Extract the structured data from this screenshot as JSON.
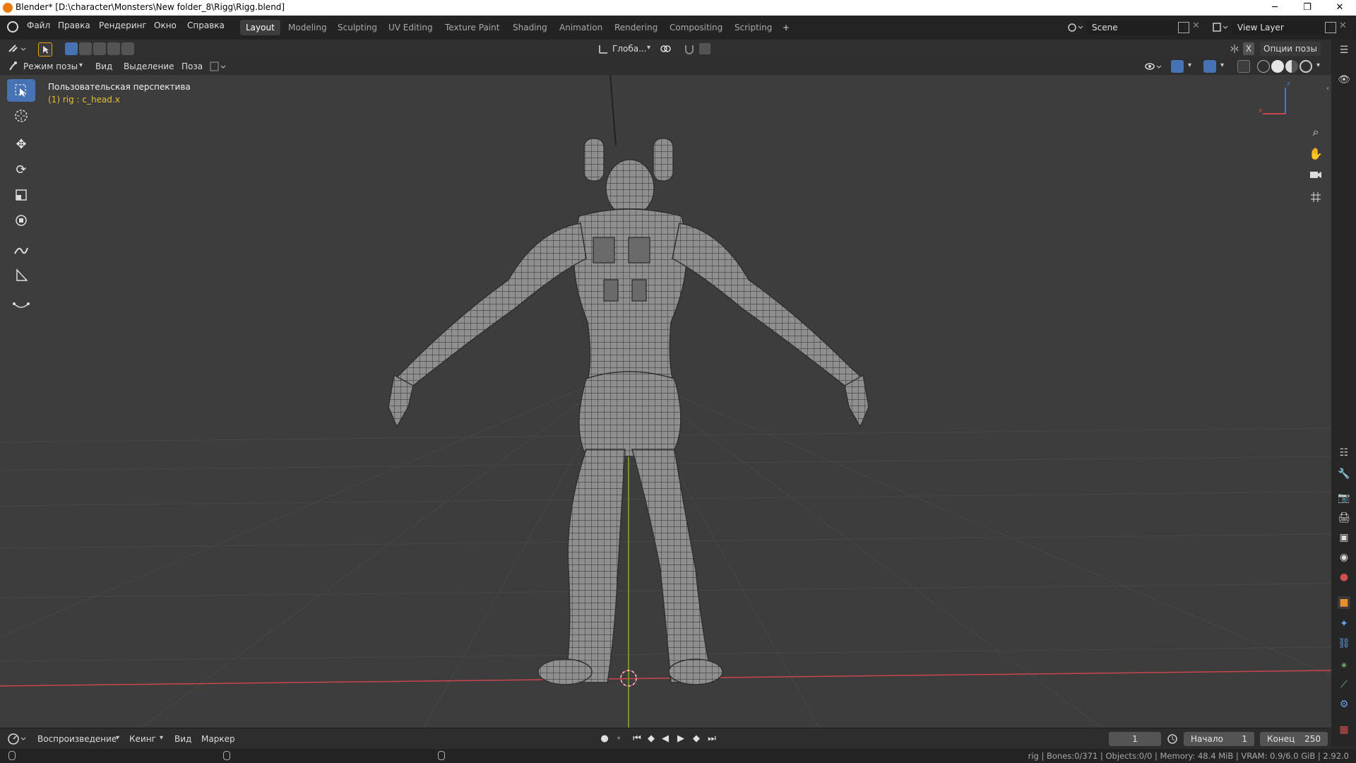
{
  "window": {
    "title": "Blender* [D:\\character\\Monsters\\New folder_8\\Rigg\\Rigg.blend]",
    "minimize": "─",
    "maximize": "❐",
    "close": "✕"
  },
  "menu": [
    "Файл",
    "Правка",
    "Рендеринг",
    "Окно",
    "Справка"
  ],
  "workspaces": [
    {
      "label": "Layout",
      "active": true
    },
    {
      "label": "Modeling"
    },
    {
      "label": "Sculpting"
    },
    {
      "label": "UV Editing"
    },
    {
      "label": "Texture Paint"
    },
    {
      "label": "Shading"
    },
    {
      "label": "Animation"
    },
    {
      "label": "Rendering"
    },
    {
      "label": "Compositing"
    },
    {
      "label": "Scripting"
    }
  ],
  "add_workspace": "+",
  "scene": {
    "value": "Scene"
  },
  "view_layer": {
    "value": "View Layer"
  },
  "header": {
    "transform_orientation": "Глоба...",
    "pose_options": "Опции позы"
  },
  "viewport_header": {
    "mode": "Режим позы",
    "view": "Вид",
    "select": "Выделение",
    "pose": "Поза"
  },
  "viewport": {
    "perspective_label": "Пользовательская перспектива",
    "active_object_label": "(1) rig : c_head.x",
    "axis_z": "z",
    "axis_x": "x"
  },
  "timeline": {
    "playback": "Воспроизведение",
    "keying": "Кеинг",
    "view": "Вид",
    "marker": "Маркер",
    "current_frame": "1",
    "start_label": "Начало",
    "start": "1",
    "end_label": "Конец",
    "end": "250"
  },
  "statusbar": {
    "stats": "rig | Bones:0/371 | Objects:0/0 | Memory: 48.4 MiB | VRAM: 0.9/6.0 GiB | 2.92.0"
  },
  "colors": {
    "accent": "#4772b3",
    "viewport_bg": "#3d3d3d",
    "active_text": "#e6c030",
    "x_axis": "#c9464b",
    "y_axis": "#7fae2c"
  }
}
